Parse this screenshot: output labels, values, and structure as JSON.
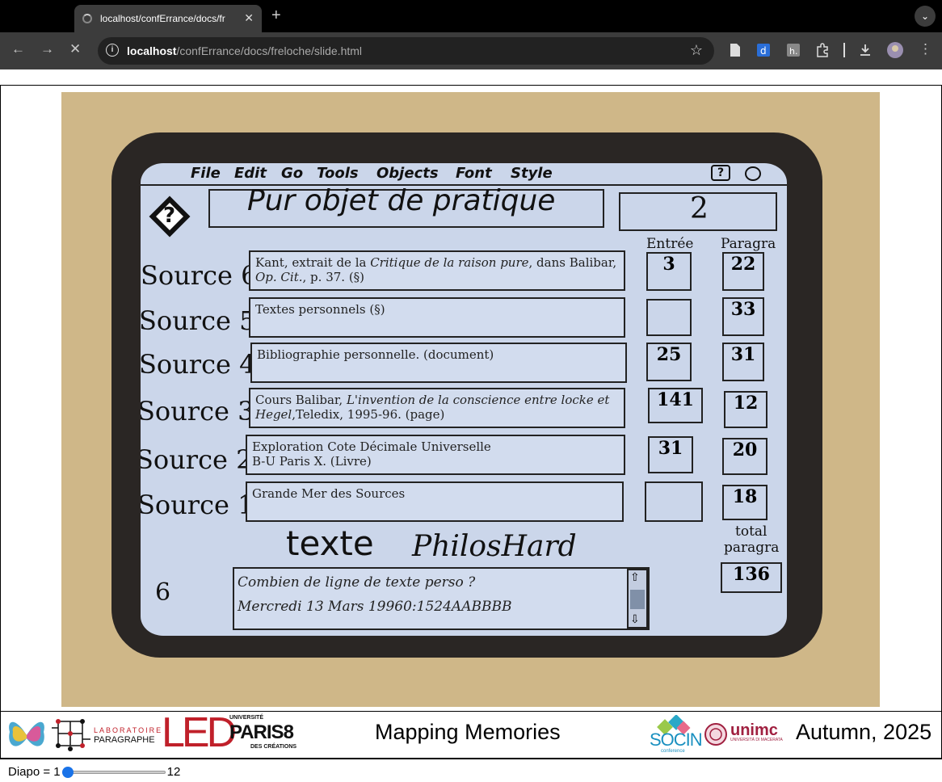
{
  "browser": {
    "tab_title": "localhost/confErrance/docs/fr",
    "url_host": "localhost",
    "url_path": "/confErrance/docs/freloche/slide.html"
  },
  "screen": {
    "menu": [
      "File",
      "Edit",
      "Go",
      "Tools",
      "Objects",
      "Font",
      "Style"
    ],
    "card_title": "Pur objet de pratique",
    "card_number": "2",
    "col_entree": "Entrée",
    "col_paragra": "Paragra",
    "sources": [
      {
        "label": "Source 6",
        "text_plain": "Kant, extrait de la ",
        "text_italic": "Critique de la raison pure",
        "text_rest": ", dans Balibar, ",
        "text_line2_italic": "Op. Cit.",
        "text_line2": ", p. 37. (§)",
        "entree": "3",
        "paragra": "22"
      },
      {
        "label": "Source 5",
        "text_plain": "Textes personnels (§)",
        "text_italic": "",
        "text_rest": "",
        "text_line2_italic": "",
        "text_line2": "",
        "entree": "",
        "paragra": "33"
      },
      {
        "label": "Source 4",
        "text_plain": "Bibliographie personnelle. (document)",
        "text_italic": "",
        "text_rest": "",
        "text_line2_italic": "",
        "text_line2": "",
        "entree": "25",
        "paragra": "31"
      },
      {
        "label": "Source 3",
        "text_plain": "Cours Balibar, ",
        "text_italic": "L'invention de la conscience entre locke et",
        "text_rest": "",
        "text_line2_italic": "Hegel",
        "text_line2": ",Teledix, 1995-96. (page)",
        "entree": "141",
        "paragra": "12"
      },
      {
        "label": "Source 2",
        "text_plain": "Exploration Cote Décimale Universelle",
        "text_italic": "",
        "text_rest": "",
        "text_line2_italic": "",
        "text_line2": "B-U Paris X. (Livre)",
        "entree": "31",
        "paragra": "20"
      },
      {
        "label": "Source 1",
        "text_plain": "Grande Mer des Sources",
        "text_italic": "",
        "text_rest": "",
        "text_line2_italic": "",
        "text_line2": "",
        "entree": "",
        "paragra": "18"
      }
    ],
    "texte_label": "texte",
    "philoshard_label": "PhilosHard",
    "total_label_1": "total",
    "total_label_2": "paragra",
    "total_value": "136",
    "page_num": "6",
    "note_line1": "Combien de ligne de texte perso ?",
    "note_line2": "Mercredi 13 Mars 19960:1524AABBBB"
  },
  "footer": {
    "labo_line1": "LABORATOIRE",
    "labo_line2": "PARAGRAPHE",
    "led": "LED",
    "univ": "UNIVERSITÉ",
    "paris": "PARIS8",
    "creations": "DES CRÉATIONS",
    "title": "Mapping Memories",
    "socin": "SOCIN",
    "socin_sub": "conference",
    "unimc": "unimc",
    "unimc_sub": "UNIVERSITÀ DI MACERATA",
    "date": "Autumn, 2025"
  },
  "slider": {
    "prefix": "Diapo = 1",
    "max": "12",
    "value_fraction": 0.0
  },
  "colors": {
    "accent": "#1a73e8",
    "screen_bg": "#cbd6ea",
    "bezel": "#2a2624",
    "case": "#cfb788"
  }
}
